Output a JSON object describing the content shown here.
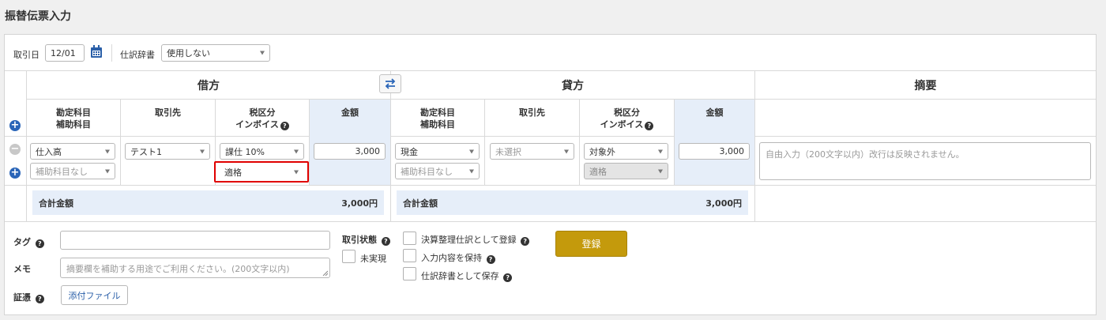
{
  "page": {
    "title": "振替伝票入力"
  },
  "toolbar": {
    "date_label": "取引日",
    "date_value": "12/01",
    "dictionary_label": "仕訳辞書",
    "dictionary_value": "使用しない"
  },
  "table": {
    "debit_header": "借方",
    "credit_header": "貸方",
    "memo_header": "摘要",
    "columns": {
      "account_line1": "勘定科目",
      "account_line2": "補助科目",
      "partner": "取引先",
      "tax_line1": "税区分",
      "tax_line2": "インボイス",
      "amount": "金額"
    },
    "debit_row": {
      "account": "仕入高",
      "sub_account": "補助科目なし",
      "partner": "テスト1",
      "tax": "課仕 10%",
      "invoice": "適格",
      "amount": "3,000"
    },
    "credit_row": {
      "account": "現金",
      "sub_account": "補助科目なし",
      "partner": "未選択",
      "tax": "対象外",
      "invoice": "適格",
      "amount": "3,000"
    },
    "memo_placeholder": "自由入力（200文字以内）改行は反映されません。",
    "total_label": "合計金額",
    "debit_total": "3,000円",
    "credit_total": "3,000円"
  },
  "footer": {
    "tag_label": "タグ",
    "memo_label": "メモ",
    "memo_placeholder": "摘要欄を補助する用途でご利用ください。(200文字以内)",
    "evidence_label": "証憑",
    "attach_button": "添付ファイル",
    "status_label": "取引状態",
    "unrealized_label": "未実現",
    "settlement_label": "決算整理仕訳として登録",
    "keep_input_label": "入力内容を保持",
    "save_dictionary_label": "仕訳辞書として保存",
    "register_button": "登録"
  }
}
